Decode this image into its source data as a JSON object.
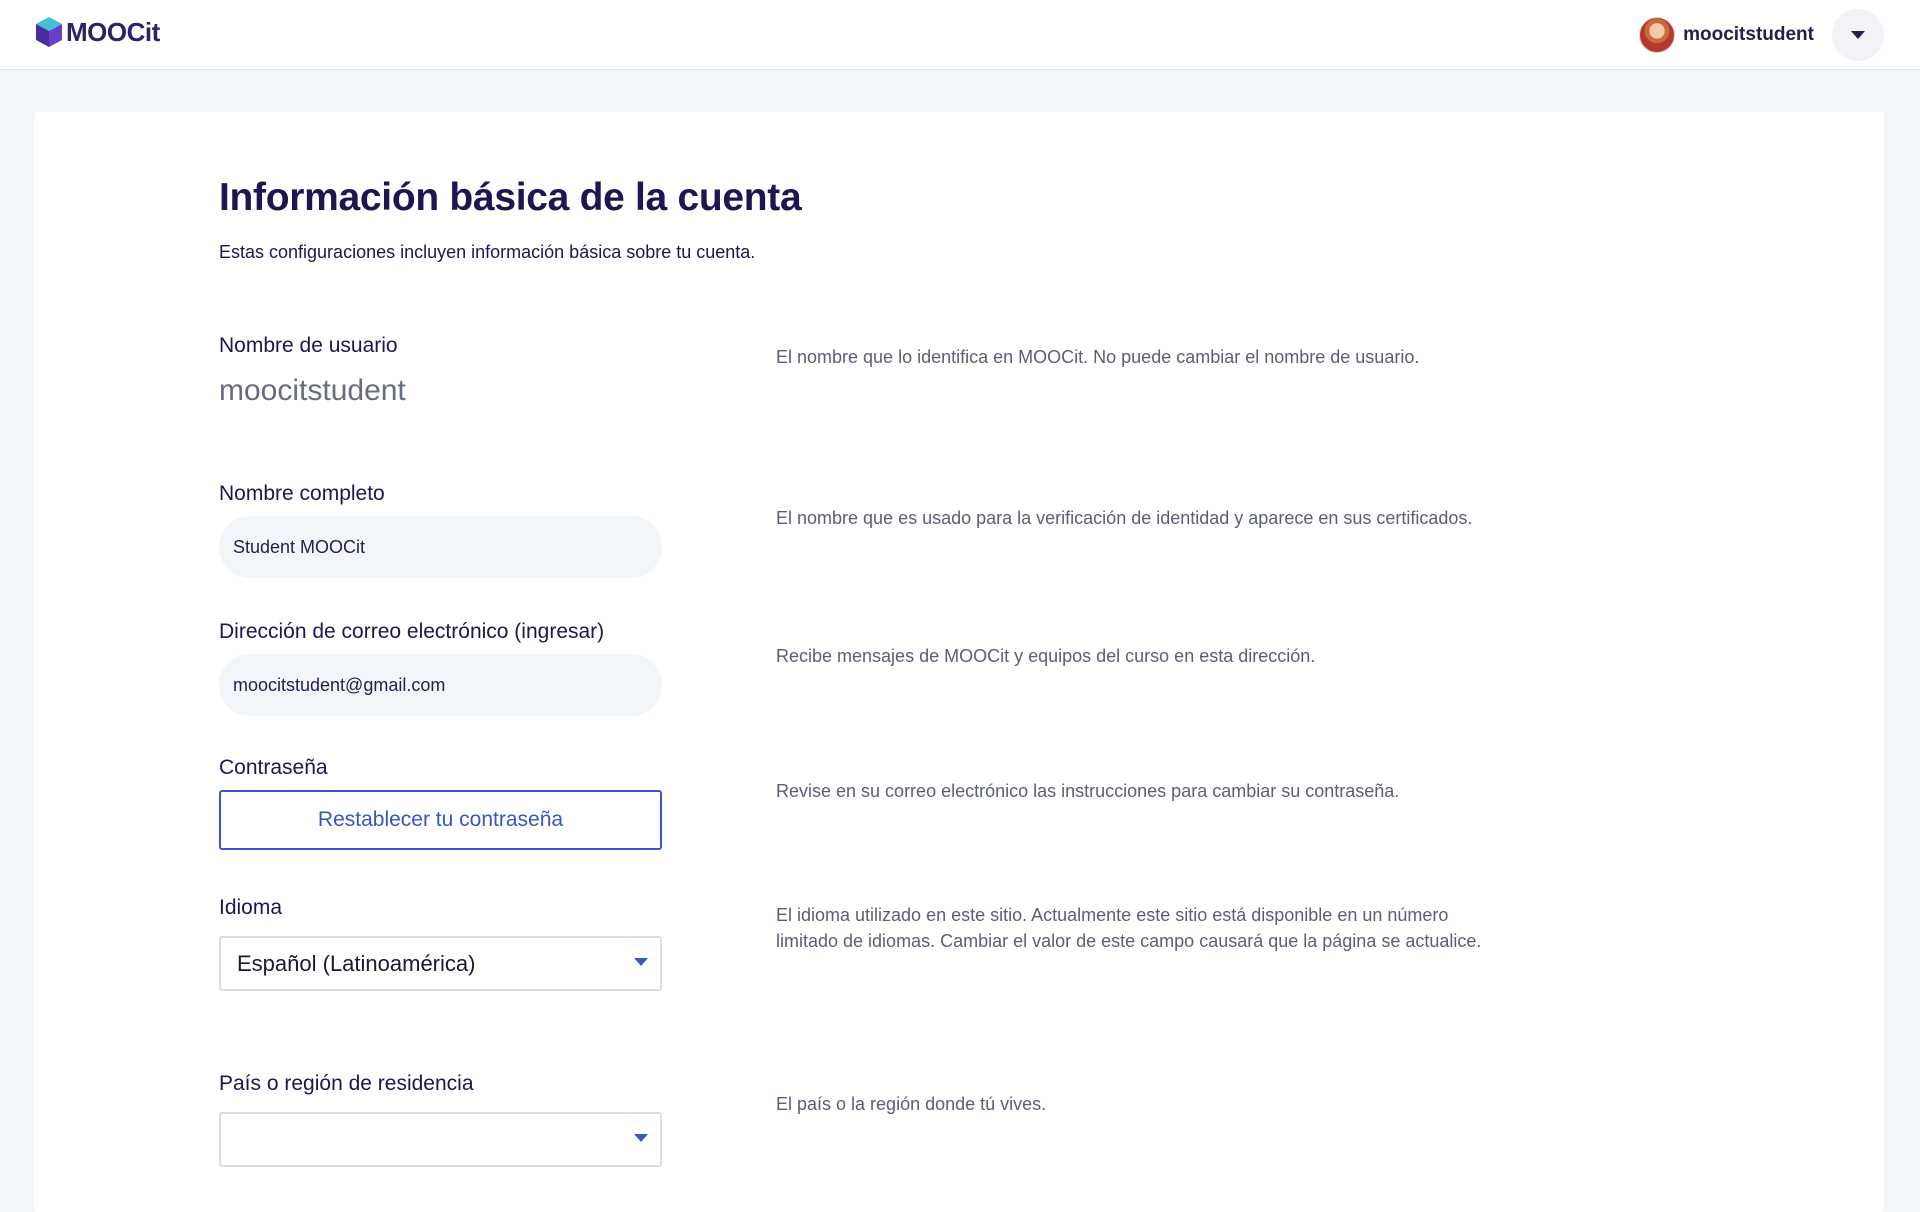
{
  "header": {
    "brand": "MOOCit",
    "username": "moocitstudent",
    "colors": {
      "brand_purple": "#4b2c9e",
      "accent_blue": "#3a56c4",
      "heading": "#1f1551"
    }
  },
  "section": {
    "title": "Información básica de la cuenta",
    "subtitle": "Estas configuraciones incluyen información básica sobre tu cuenta."
  },
  "fields": {
    "username": {
      "label": "Nombre de usuario",
      "value": "moocitstudent",
      "help": "El nombre que lo identifica en MOOCit. No puede cambiar el nombre de usuario."
    },
    "full_name": {
      "label": "Nombre completo",
      "value": "Student MOOCit",
      "help": "El nombre que es usado para la verificación de identidad y aparece en sus certificados."
    },
    "email": {
      "label": "Dirección de correo electrónico (ingresar)",
      "value": "moocitstudent@gmail.com",
      "help": "Recibe mensajes de MOOCit y equipos del curso en esta dirección."
    },
    "password": {
      "label": "Contraseña",
      "button": "Restablecer tu contraseña",
      "help": "Revise en su correo electrónico las instrucciones para cambiar su contraseña."
    },
    "language": {
      "label": "Idioma",
      "selected": "Español (Latinoamérica)",
      "help_line1": "El idioma utilizado en este sitio. Actualmente este sitio está disponible en un número",
      "help_line2": "limitado de idiomas. Cambiar el valor de este campo causará que la página se actualice."
    },
    "country": {
      "label": "País o región de residencia",
      "selected": "",
      "help": "El país o la región donde tú vives."
    }
  },
  "icons": [
    "moocit-logo-icon",
    "avatar",
    "caret-down-icon"
  ]
}
